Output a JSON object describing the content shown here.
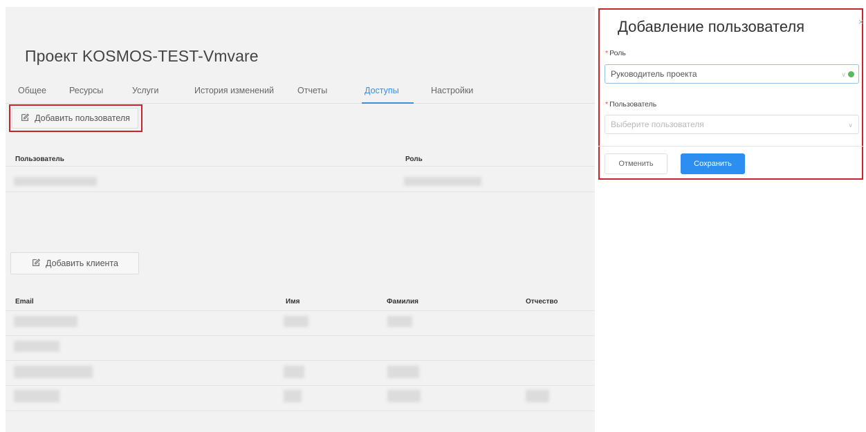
{
  "page": {
    "title": "Проект KOSMOS-TEST-Vmvare",
    "tabs": [
      {
        "label": "Общее",
        "active": false
      },
      {
        "label": "Ресурсы",
        "active": false
      },
      {
        "label": "Услуги",
        "active": false
      },
      {
        "label": "История изменений",
        "active": false
      },
      {
        "label": "Отчеты",
        "active": false
      },
      {
        "label": "Доступы",
        "active": true
      },
      {
        "label": "Настройки",
        "active": false
      }
    ],
    "add_user_label": "Добавить пользователя",
    "users_table": {
      "columns": [
        "Пользователь",
        "Роль"
      ]
    },
    "add_client_label": "Добавить клиента",
    "clients_table": {
      "columns": [
        "Email",
        "Имя",
        "Фамилия",
        "Отчество"
      ]
    }
  },
  "drawer": {
    "title": "Добавление пользователя",
    "close_glyph": "×",
    "role_label": "Роль",
    "role_value": "Руководитель проекта",
    "user_label": "Пользователь",
    "user_placeholder": "Выберите пользователя",
    "cancel_label": "Отменить",
    "save_label": "Сохранить"
  },
  "colors": {
    "accent": "#3a8ee6",
    "primary_button": "#2b8ef0",
    "highlight": "#c8232c",
    "valid": "#5cb85c"
  },
  "icons": {
    "add": "edit-square-icon",
    "close": "close-icon",
    "chevron": "chevron-down-icon",
    "valid": "check-circle-icon"
  }
}
